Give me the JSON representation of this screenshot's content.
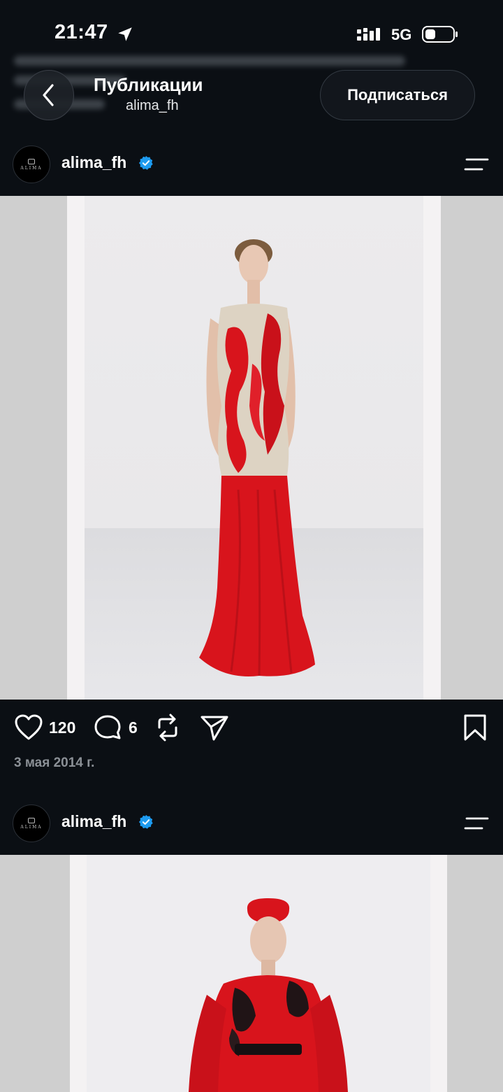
{
  "status_bar": {
    "time": "21:47",
    "network": "5G"
  },
  "header": {
    "title": "Публикации",
    "username": "alima_fh",
    "follow_label": "Подписаться"
  },
  "posts": [
    {
      "author": "alima_fh",
      "avatar_text": "ALIMA",
      "likes": "120",
      "comments": "6",
      "date": "3 мая 2014 г."
    },
    {
      "author": "alima_fh",
      "avatar_text": "ALIMA"
    }
  ],
  "colors": {
    "background": "#0b0f14",
    "verified": "#1d9bf0",
    "dress_red": "#d8141c"
  },
  "icons": [
    "back-icon",
    "location-arrow-icon",
    "signal-icon",
    "battery-icon",
    "verified-icon",
    "menu-icon",
    "heart-icon",
    "comment-icon",
    "repost-icon",
    "share-icon",
    "bookmark-icon"
  ]
}
